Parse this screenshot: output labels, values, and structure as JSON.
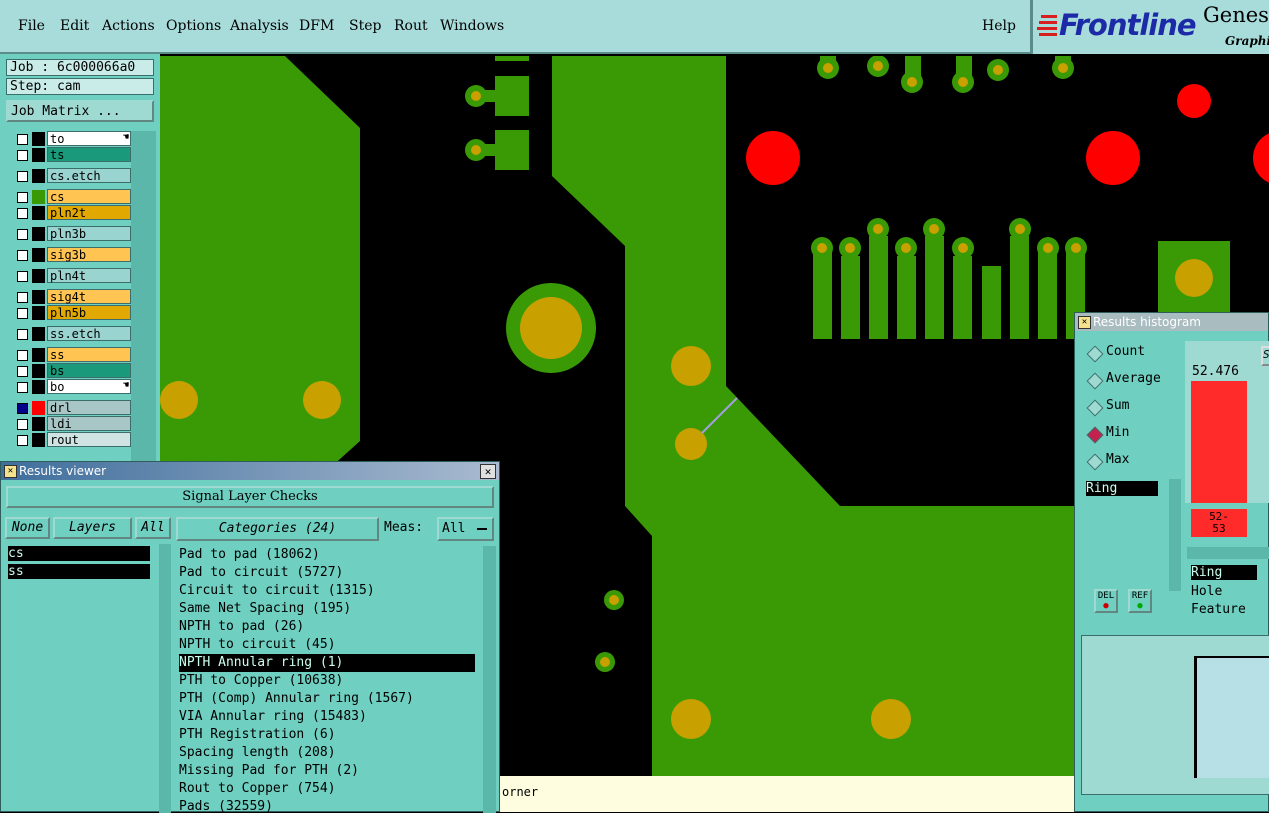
{
  "menu": {
    "items": [
      "File",
      "Edit",
      "Actions",
      "Options",
      "Analysis",
      "DFM",
      "Step",
      "Rout",
      "Windows"
    ],
    "help": "Help"
  },
  "brand": {
    "logo": "Frontline",
    "product": "Genesi",
    "sub": "Graphic"
  },
  "job": {
    "job_label": "Job : 6c000066a0",
    "step_label": "Step: cam",
    "matrix_button": "Job Matrix ..."
  },
  "layers": [
    {
      "name": "to",
      "color": "#ffffff",
      "swatch": "#000000",
      "hand": true
    },
    {
      "name": "ts",
      "color": "#1a9a7a",
      "swatch": "#000000"
    },
    {
      "name": "cs.etch",
      "color": "#9ad4d0",
      "swatch": "#000000"
    },
    {
      "name": "cs",
      "color": "#ffc451",
      "swatch": "#3a9a06"
    },
    {
      "name": "pln2t",
      "color": "#e0a800",
      "swatch": "#000000"
    },
    {
      "name": "pln3b",
      "color": "#9ad4d0",
      "swatch": "#000000"
    },
    {
      "name": "sig3b",
      "color": "#ffc451",
      "swatch": "#000000"
    },
    {
      "name": "pln4t",
      "color": "#9ad4d0",
      "swatch": "#000000"
    },
    {
      "name": "sig4t",
      "color": "#ffc451",
      "swatch": "#000000"
    },
    {
      "name": "pln5b",
      "color": "#e0a800",
      "swatch": "#000000"
    },
    {
      "name": "ss.etch",
      "color": "#9ad4d0",
      "swatch": "#000000"
    },
    {
      "name": "ss",
      "color": "#ffc451",
      "swatch": "#000000"
    },
    {
      "name": "bs",
      "color": "#1a9a7a",
      "swatch": "#000000"
    },
    {
      "name": "bo",
      "color": "#ffffff",
      "swatch": "#000000",
      "hand": true
    },
    {
      "name": "drl",
      "color": "#a9c6c6",
      "swatch": "#ff0000"
    },
    {
      "name": "ldi",
      "color": "#a9c6c6",
      "swatch": "#000000"
    },
    {
      "name": "rout",
      "color": "#cfe3e3",
      "swatch": "#000000"
    }
  ],
  "results_viewer": {
    "title": "Results viewer",
    "header": "Signal Layer Checks",
    "none_btn": "None",
    "layers_btn": "Layers",
    "all_btn": "All",
    "layer_list": [
      "cs",
      "ss"
    ],
    "categories_btn": "Categories (24)",
    "meas_label": "Meas:",
    "meas_value": "All",
    "categories": [
      "Pad to pad (18062)",
      "Pad to circuit (5727)",
      "Circuit to circuit (1315)",
      "Same Net Spacing (195)",
      "NPTH to pad (26)",
      "NPTH to circuit (45)",
      "NPTH Annular ring (1)",
      "PTH to Copper (10638)",
      "PTH (Comp) Annular ring (1567)",
      "VIA Annular ring (15483)",
      "PTH Registration (6)",
      "Spacing length (208)",
      "Missing Pad for PTH (2)",
      "Rout to Copper (754)",
      "Pads (32559)"
    ],
    "selected_category": 6
  },
  "status_bar": {
    "text": "orner"
  },
  "histogram": {
    "title": "Results histogram",
    "modes": [
      "Count",
      "Average",
      "Sum",
      "Min",
      "Max"
    ],
    "selected_mode": "Min",
    "list_selected": "Ring",
    "del_btn": "DEL",
    "ref_btn": "REF",
    "bar_value": "52.476",
    "bar_range": "52-\n53",
    "cut_btn": "S",
    "fields": [
      "Ring",
      "Hole",
      "Feature"
    ]
  }
}
